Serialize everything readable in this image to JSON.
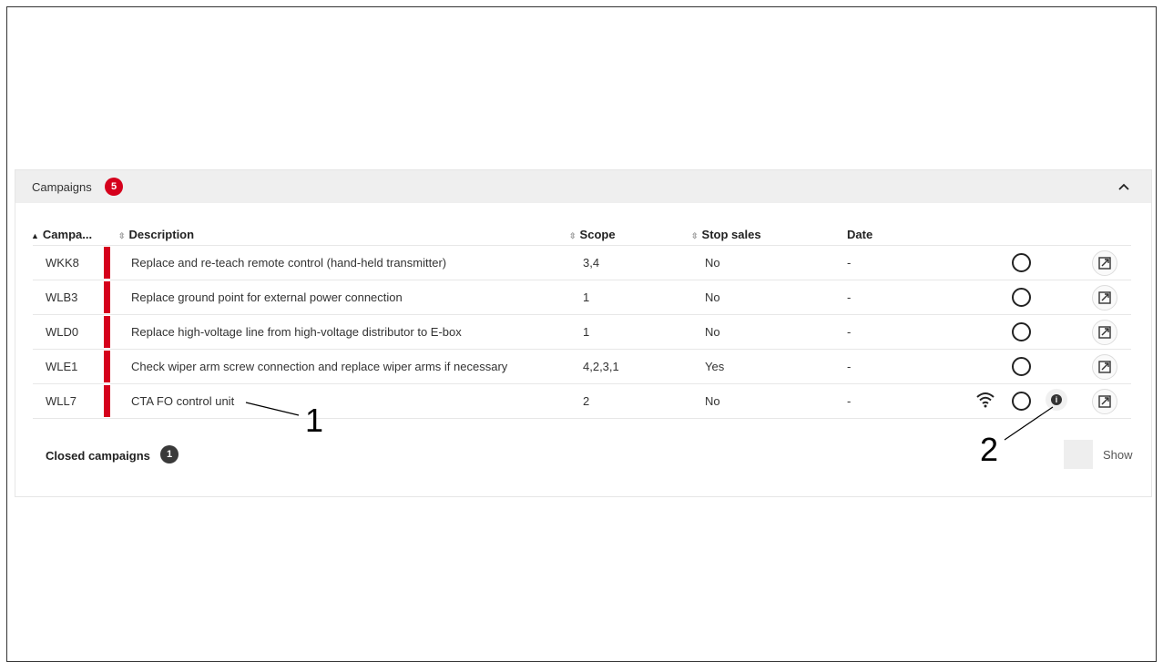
{
  "campaigns": {
    "title": "Campaigns",
    "count": "5",
    "columns": {
      "campaign": "Campa...",
      "description": "Description",
      "scope": "Scope",
      "stop_sales": "Stop sales",
      "date": "Date"
    },
    "rows": [
      {
        "code": "WKK8",
        "description": "Replace and re-teach remote control (hand-held transmitter)",
        "scope": "3,4",
        "stop_sales": "No",
        "date": "-"
      },
      {
        "code": "WLB3",
        "description": "Replace ground point for external power connection",
        "scope": "1",
        "stop_sales": "No",
        "date": "-"
      },
      {
        "code": "WLD0",
        "description": "Replace high-voltage line from high-voltage distributor to E-box",
        "scope": "1",
        "stop_sales": "No",
        "date": "-"
      },
      {
        "code": "WLE1",
        "description": "Check wiper arm screw connection and replace wiper arms if necessary",
        "scope": "4,2,3,1",
        "stop_sales": "Yes",
        "date": "-"
      },
      {
        "code": "WLL7",
        "description": "CTA FO control unit",
        "scope": "2",
        "stop_sales": "No",
        "date": "-"
      }
    ]
  },
  "closed": {
    "label": "Closed campaigns",
    "count": "1",
    "show_label": "Show"
  },
  "callouts": {
    "one": "1",
    "two": "2"
  },
  "colors": {
    "accent_red": "#d5001c",
    "header_bg": "#efefef"
  },
  "icons": [
    "chevron-up-icon",
    "sort-icon",
    "status-circle-icon",
    "edit-external-icon",
    "wifi-icon",
    "info-icon"
  ]
}
